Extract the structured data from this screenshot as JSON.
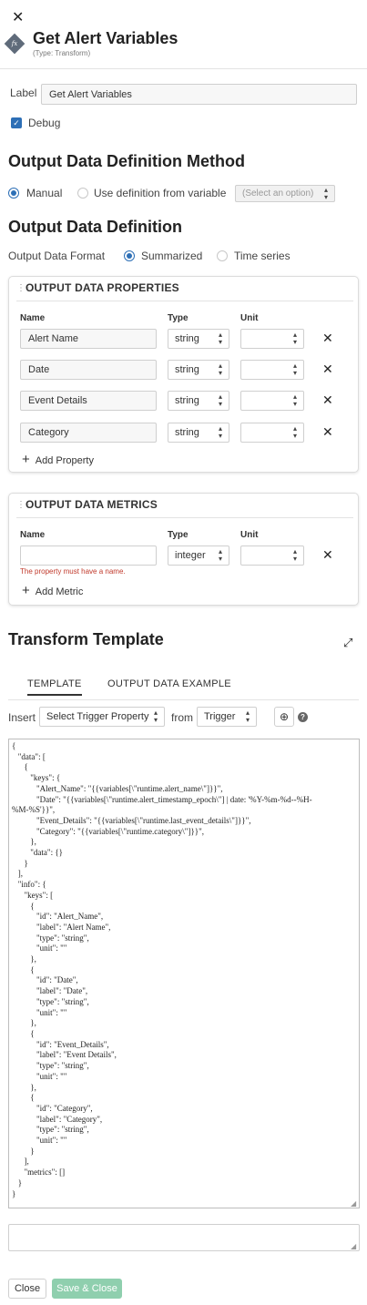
{
  "header": {
    "close_glyph": "✕",
    "title": "Get Alert Variables",
    "subtitle": "(Type: Transform)",
    "icon": "fx-icon"
  },
  "label_field": {
    "label": "Label",
    "value": "Get Alert Variables"
  },
  "debug": {
    "label": "Debug",
    "checked": true
  },
  "method": {
    "heading": "Output Data Definition Method",
    "manual": "Manual",
    "from_variable": "Use definition from variable",
    "variable_select": "(Select an option)",
    "selected": "manual"
  },
  "definition": {
    "heading": "Output Data Definition",
    "format_label": "Output Data Format",
    "summarized": "Summarized",
    "time_series": "Time series",
    "selected": "summarized"
  },
  "properties": {
    "heading": "OUTPUT DATA PROPERTIES",
    "col_name": "Name",
    "col_type": "Type",
    "col_unit": "Unit",
    "rows": [
      {
        "name": "Alert Name",
        "type": "string",
        "unit": ""
      },
      {
        "name": "Date",
        "type": "string",
        "unit": ""
      },
      {
        "name": "Event Details",
        "type": "string",
        "unit": ""
      },
      {
        "name": "Category",
        "type": "string",
        "unit": ""
      }
    ],
    "add_label": "Add Property"
  },
  "metrics": {
    "heading": "OUTPUT DATA METRICS",
    "col_name": "Name",
    "col_type": "Type",
    "col_unit": "Unit",
    "rows": [
      {
        "name": "",
        "type": "integer",
        "unit": ""
      }
    ],
    "error": "The property must have a name.",
    "add_label": "Add Metric"
  },
  "template": {
    "heading": "Transform Template",
    "tabs": [
      "TEMPLATE",
      "OUTPUT DATA EXAMPLE"
    ],
    "active_tab": 0,
    "insert_label": "Insert",
    "insert_select": "Select Trigger Property",
    "from_label": "from",
    "from_select": "Trigger",
    "code": "{\n   \"data\": [\n      {\n         \"keys\": {\n            \"Alert_Name\": \"{{variables[\\\"runtime.alert_name\\\"]}}\",\n            \"Date\": \"{{variables[\\\"runtime.alert_timestamp_epoch\\\"] | date: '%Y-%m-%d--%H-\n%M-%S'}}\",\n            \"Event_Details\": \"{{variables[\\\"runtime.last_event_details\\\"]}}\",\n            \"Category\": \"{{variables[\\\"runtime.category\\\"]}}\",\n         },\n         \"data\": {}\n      }\n   ],\n   \"info\": {\n      \"keys\": [\n         {\n            \"id\": \"Alert_Name\",\n            \"label\": \"Alert Name\",\n            \"type\": \"string\",\n            \"unit\": \"\"\n         },\n         {\n            \"id\": \"Date\",\n            \"label\": \"Date\",\n            \"type\": \"string\",\n            \"unit\": \"\"\n         },\n         {\n            \"id\": \"Event_Details\",\n            \"label\": \"Event Details\",\n            \"type\": \"string\",\n            \"unit\": \"\"\n         },\n         {\n            \"id\": \"Category\",\n            \"label\": \"Category\",\n            \"type\": \"string\",\n            \"unit\": \"\"\n         }\n      ],\n      \"metrics\": []\n   }\n}",
    "notes_value": ""
  },
  "footer": {
    "close_label": "Close",
    "save_label": "Save & Close"
  },
  "colors": {
    "accent": "#2d6fb6",
    "error": "#c0392b",
    "save_disabled": "#8fcfae"
  }
}
